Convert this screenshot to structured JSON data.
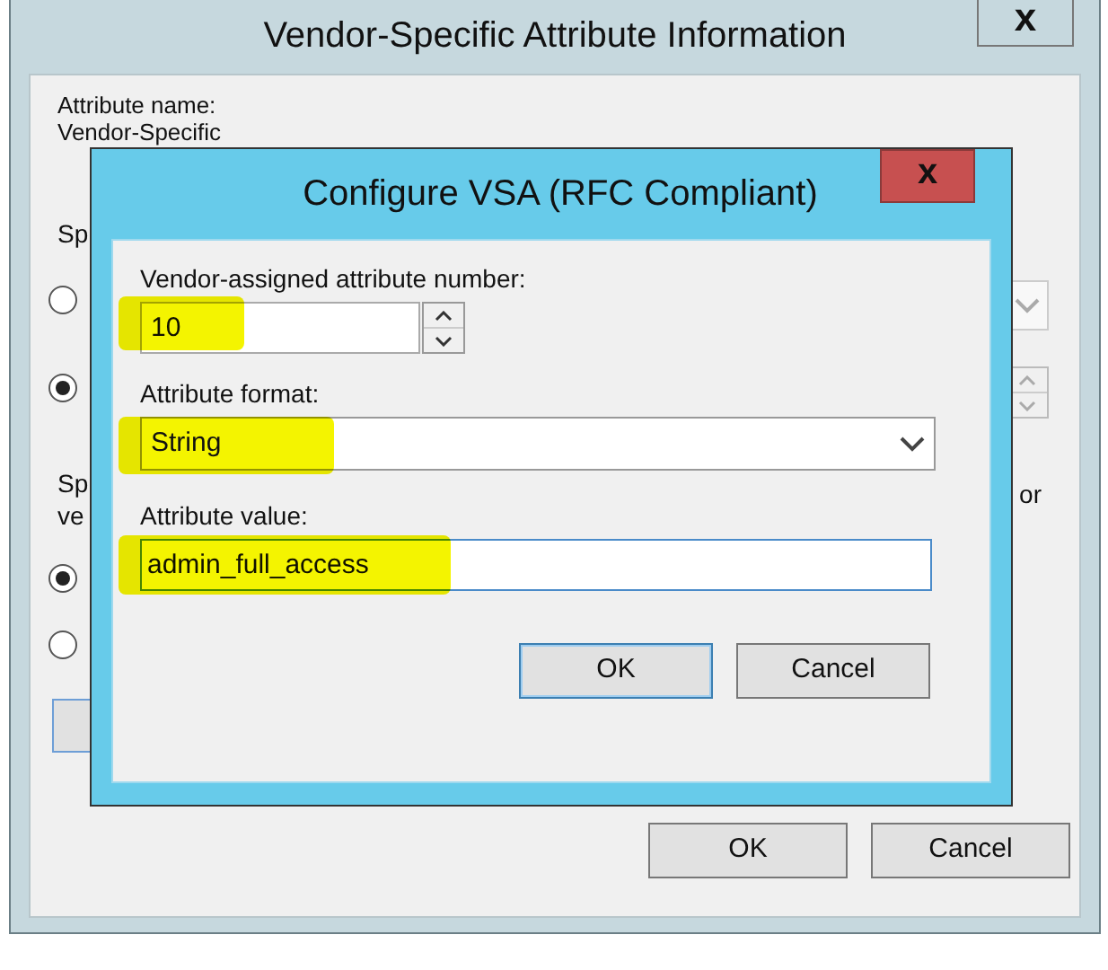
{
  "back_window": {
    "title": "Vendor-Specific Attribute Information",
    "close_glyph": "x",
    "attribute_name_label": "Attribute name:",
    "attribute_name_value": "Vendor-Specific",
    "section_1_label": "Sp",
    "radios_1": [
      {
        "selected": false
      },
      {
        "selected": true
      }
    ],
    "section_2_label": [
      "Sp",
      "ve"
    ],
    "section_2_right_text": "or",
    "radios_2": [
      {
        "selected": true
      },
      {
        "selected": false
      }
    ],
    "buttons": [
      "OK",
      "Cancel"
    ]
  },
  "dialog": {
    "title": "Configure VSA (RFC Compliant)",
    "close_glyph": "x",
    "number_label": "Vendor-assigned attribute number:",
    "number_value": "10",
    "format_label": "Attribute format:",
    "format_value": "String",
    "value_label": "Attribute value:",
    "value_value": "admin_full_access",
    "buttons": [
      {
        "label": "OK",
        "default": true
      },
      {
        "label": "Cancel",
        "default": false
      }
    ]
  }
}
